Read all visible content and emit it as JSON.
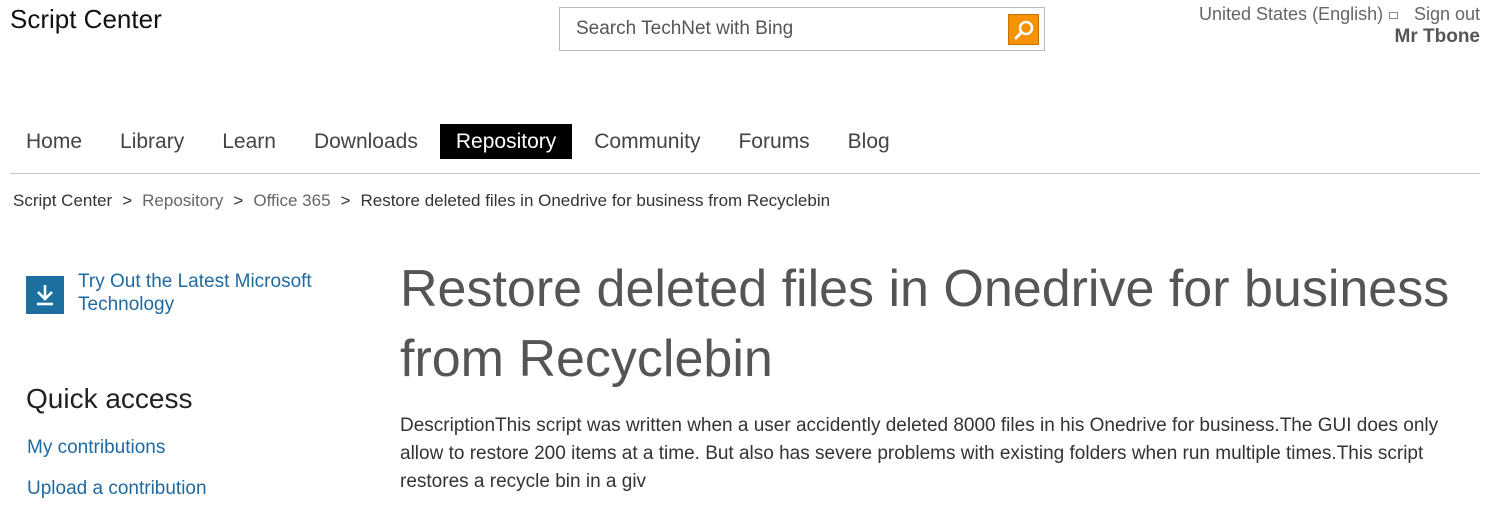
{
  "header": {
    "site_title": "Script Center",
    "search_placeholder": "Search TechNet with Bing",
    "locale": "United States (English)",
    "sign_out": "Sign out",
    "user_name": "Mr Tbone"
  },
  "nav": {
    "items": [
      {
        "label": "Home"
      },
      {
        "label": "Library"
      },
      {
        "label": "Learn"
      },
      {
        "label": "Downloads"
      },
      {
        "label": "Repository"
      },
      {
        "label": "Community"
      },
      {
        "label": "Forums"
      },
      {
        "label": "Blog"
      }
    ],
    "active": "Repository"
  },
  "breadcrumb": {
    "items": [
      "Script Center",
      "Repository",
      "Office 365",
      "Restore deleted files in Onedrive for business from Recyclebin"
    ],
    "separator": ">"
  },
  "sidebar": {
    "promo_link": "Try Out the Latest Microsoft Technology",
    "promo_icon": "download-icon",
    "quick_access_heading": "Quick access",
    "links": [
      "My contributions",
      "Upload a contribution"
    ]
  },
  "main": {
    "title": "Restore deleted files in Onedrive for business from Recyclebin",
    "description": "DescriptionThis script was written when a user accidently deleted 8000 files in his Onedrive for business.The GUI does only allow to restore 200 items at a time. But also has severe problems with existing folders when run multiple times.This script restores a recycle bin in a giv"
  },
  "colors": {
    "link": "#1f6aa0",
    "search_button": "#f69100",
    "promo_icon_bg": "#1c6f9f",
    "nav_active_bg": "#000000"
  }
}
